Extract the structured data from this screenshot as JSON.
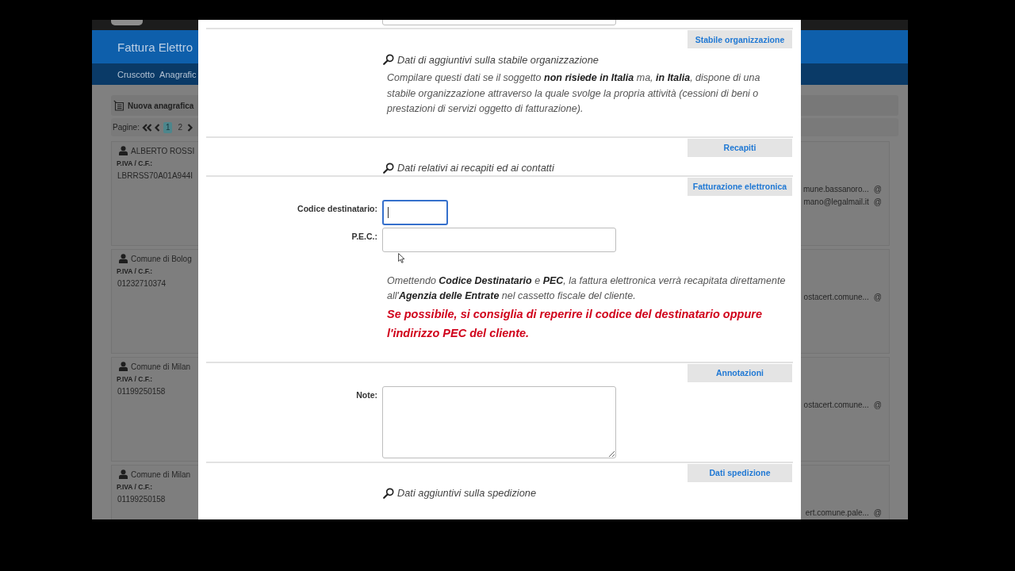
{
  "app": {
    "title": "Fattura Elettro",
    "nav": [
      "Cruscotto",
      "Anagrafic"
    ],
    "new_button": "Nuova anagrafica",
    "pagination": {
      "label": "Pagine:",
      "pages": [
        {
          "label": "1",
          "selected": true
        },
        {
          "label": "2",
          "selected": false
        }
      ]
    },
    "cards": [
      {
        "name": "ALBERTO ROSSI",
        "id_label": "P.IVA / C.F.:",
        "id": "LBRRSS70A01A944I",
        "emails": [
          {
            "address": "mune.bassanoro...",
            "symbol": "@"
          },
          {
            "address": "mano@legalmail.it",
            "symbol": "@"
          }
        ]
      },
      {
        "name": "Comune di Bolog",
        "id_label": "P.IVA / C.F.:",
        "id": "01232710374",
        "emails": [
          {
            "address": "ostacert.comune...",
            "symbol": "@"
          }
        ]
      },
      {
        "name": "Comune di Milan",
        "id_label": "P.IVA / C.F.:",
        "id": "01199250158",
        "emails": [
          {
            "address": "ostacert.comune...",
            "symbol": "@"
          }
        ]
      },
      {
        "name": "Comune di Milan",
        "id_label": "P.IVA / C.F.:",
        "id": "01199250158",
        "emails": [
          {
            "address": "ert.comune.pale...",
            "symbol": "@"
          }
        ]
      }
    ]
  },
  "modal": {
    "partial_field": {
      "kind": "input"
    },
    "sections": [
      {
        "title": "Stabile organizzazione",
        "blocks": [
          {
            "kind": "hint",
            "text": "Dati di aggiuntivi sulla stabile organizzazione"
          },
          {
            "kind": "note",
            "text": "Compilare questi dati se il soggetto **non risiede in Italia** ma, **in Italia**, dispone di una stabile organizzazione attraverso la quale svolge la propria attività (cessioni di beni o prestazioni di servizi oggetto di fatturazione)."
          }
        ]
      },
      {
        "title": "Recapiti",
        "blocks": [
          {
            "kind": "hint",
            "text": "Dati relativi ai recapiti ed ai contatti"
          }
        ]
      },
      {
        "title": "Fatturazione elettronica",
        "blocks": [
          {
            "kind": "code",
            "label": "Codice destinatario:",
            "focused": true
          },
          {
            "kind": "input",
            "label": "P.E.C.:",
            "focused": false
          },
          {
            "kind": "note",
            "text": "Omettendo **Codice Destinatario** e **PEC**, la fattura elettronica verrà recapitata direttamente all'**Agenzia delle Entrate** nel cassetto fiscale del cliente."
          },
          {
            "kind": "warning",
            "text": "Se possibile, si consiglia di reperire il codice del destinatario oppure l'indirizzo PEC del cliente."
          }
        ]
      },
      {
        "title": "Annotazioni",
        "blocks": [
          {
            "kind": "textarea",
            "label": "Note:"
          }
        ]
      },
      {
        "title": "Dati spedizione",
        "blocks": [
          {
            "kind": "hint",
            "text": "Dati aggiuntivi sulla spedizione"
          }
        ]
      }
    ]
  }
}
